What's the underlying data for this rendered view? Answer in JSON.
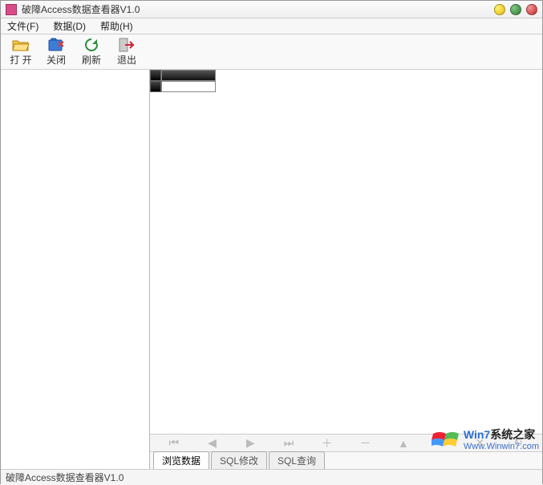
{
  "window": {
    "title": "破障Access数据查看器V1.0"
  },
  "menu": {
    "file": "文件(F)",
    "data": "数据(D)",
    "help": "帮助(H)"
  },
  "toolbar": {
    "open": "打 开",
    "close": "关闭",
    "refresh": "刷新",
    "exit": "退出"
  },
  "tabs": {
    "browse": "浏览数据",
    "sql_modify": "SQL修改",
    "sql_query": "SQL查询"
  },
  "status": {
    "text": "破障Access数据查看器V1.0"
  },
  "watermark": {
    "line1_prefix": "Win7",
    "line1_suffix": "系统之家",
    "line2": "Www.Winwin7.com"
  }
}
